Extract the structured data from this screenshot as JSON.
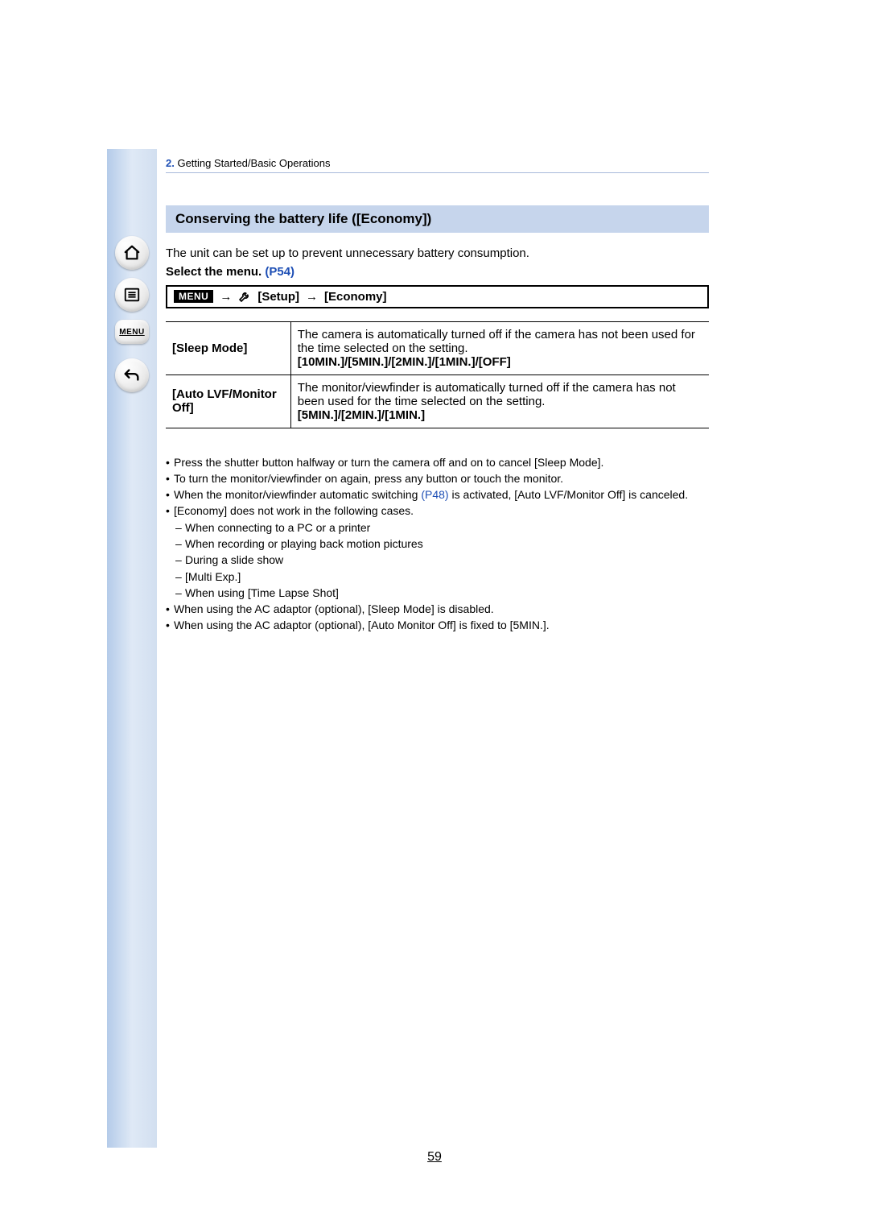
{
  "sidebar": {
    "home_icon": "home-icon",
    "toc_icon": "toc-icon",
    "menu_label": "MENU",
    "back_icon": "back-icon"
  },
  "chapter": {
    "number": "2.",
    "title": "Getting Started/Basic Operations"
  },
  "section_title": "Conserving the battery life ([Economy])",
  "intro": "The unit can be set up to prevent unnecessary battery consumption.",
  "select_line": {
    "prefix": "Select the menu.",
    "link": "(P54)"
  },
  "menu_path": {
    "badge": "MENU",
    "arrow": "→",
    "setup": "[Setup]",
    "economy": "[Economy]"
  },
  "table": [
    {
      "name": "[Sleep Mode]",
      "desc": "The camera is automatically turned off if the camera has not been used for the time selected on the setting.",
      "options": "[10MIN.]/[5MIN.]/[2MIN.]/[1MIN.]/[OFF]"
    },
    {
      "name": "[Auto LVF/Monitor Off]",
      "desc": "The monitor/viewfinder is automatically turned off if the camera has not been used for the time selected on the setting.",
      "options": "[5MIN.]/[2MIN.]/[1MIN.]"
    }
  ],
  "notes": {
    "n1": "Press the shutter button halfway or turn the camera off and on to cancel [Sleep Mode].",
    "n2": "To turn the monitor/viewfinder on again, press any button or touch the monitor.",
    "n3a": "When the monitor/viewfinder automatic switching ",
    "n3link": "(P48)",
    "n3b": " is activated, [Auto LVF/Monitor Off] is canceled.",
    "n4": "[Economy] does not work in the following cases.",
    "d1": "When connecting to a PC or a printer",
    "d2": "When recording or playing back motion pictures",
    "d3": "During a slide show",
    "d4": "[Multi Exp.]",
    "d5": "When using [Time Lapse Shot]",
    "n5": "When using the AC adaptor (optional), [Sleep Mode] is disabled.",
    "n6": "When using the AC adaptor (optional), [Auto Monitor Off] is fixed to [5MIN.]."
  },
  "page_number": "59"
}
